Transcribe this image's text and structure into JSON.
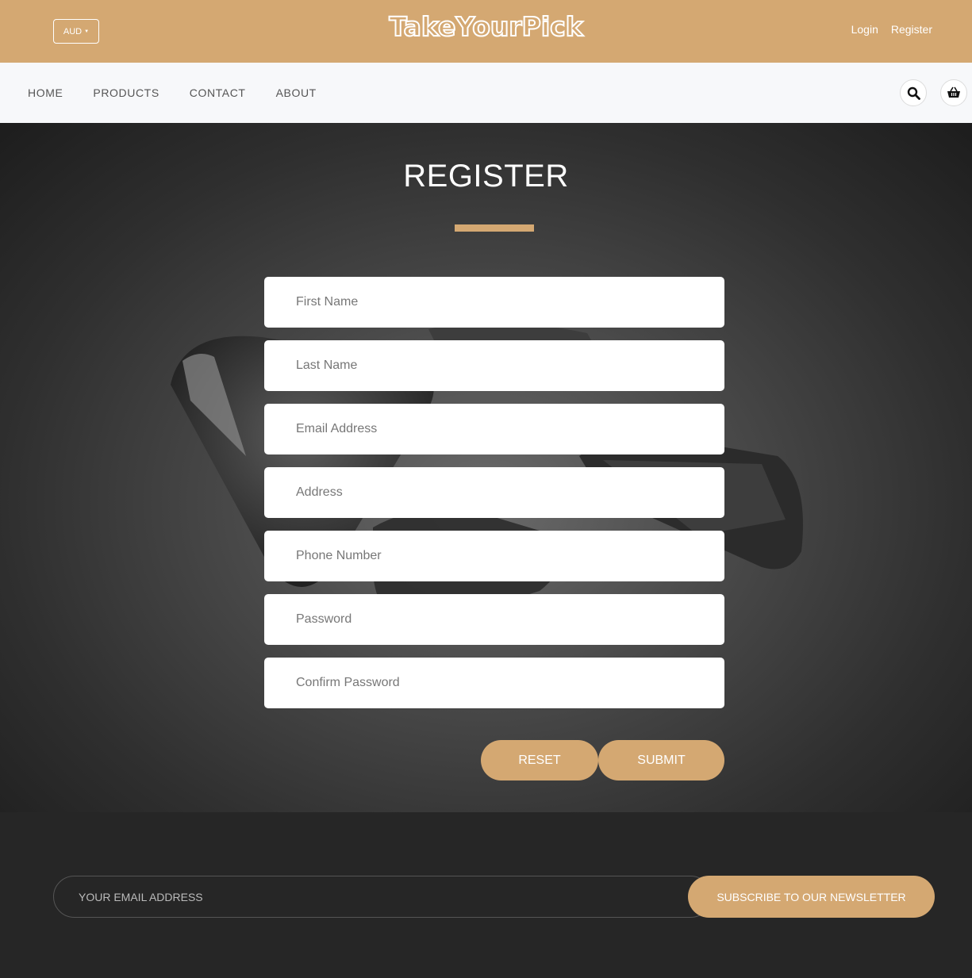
{
  "header": {
    "currency": "AUD",
    "logo": "TakeYourPick",
    "login": "Login",
    "register": "Register"
  },
  "nav": {
    "items": [
      "HOME",
      "PRODUCTS",
      "CONTACT",
      "ABOUT"
    ],
    "search_icon": "search-icon",
    "cart_icon": "basket-icon"
  },
  "form": {
    "title": "REGISTER",
    "fields": [
      {
        "placeholder": "First Name"
      },
      {
        "placeholder": "Last Name"
      },
      {
        "placeholder": "Email Address"
      },
      {
        "placeholder": "Address"
      },
      {
        "placeholder": "Phone Number"
      },
      {
        "placeholder": "Password"
      },
      {
        "placeholder": "Confirm Password"
      }
    ],
    "reset_label": "RESET",
    "submit_label": "SUBMIT"
  },
  "newsletter": {
    "placeholder": "YOUR EMAIL ADDRESS",
    "button_label": "SUBSCRIBE TO OUR NEWSLETTER"
  },
  "colors": {
    "accent": "#d4a872",
    "nav_bg": "#f7f8fa",
    "footer_bg": "#262626"
  }
}
